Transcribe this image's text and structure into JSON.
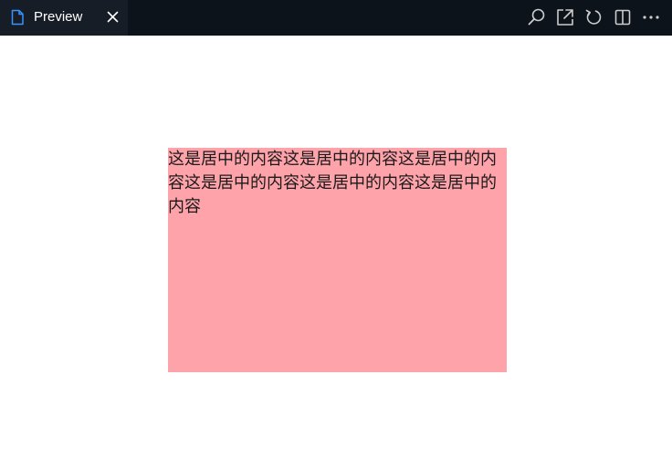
{
  "tab": {
    "title": "Preview",
    "icon": "file-icon",
    "close_icon": "close-icon"
  },
  "toolbar": {
    "icons": [
      "search-icon",
      "open-external-icon",
      "refresh-icon",
      "split-editor-icon",
      "more-icon"
    ]
  },
  "content": {
    "text": "这是居中的内容这是居中的内容这是居中的内容这是居中的内容这是居中的内容这是居中的内容",
    "box_color": "#ffa3ab"
  },
  "colors": {
    "titlebar": "#0d131b",
    "tab": "#161d27",
    "accent": "#3794ff",
    "icon": "#cccccc"
  }
}
